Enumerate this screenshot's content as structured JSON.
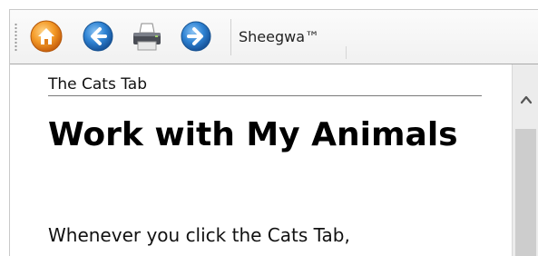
{
  "toolbar": {
    "buttons": [
      {
        "icon": "home-icon"
      },
      {
        "icon": "back-arrow-icon"
      },
      {
        "icon": "printer-icon"
      },
      {
        "icon": "forward-arrow-icon"
      }
    ],
    "brand": "Sheegwa™"
  },
  "content": {
    "breadcrumb": "The Cats Tab",
    "title": "Work with My Animals",
    "body": "Whenever you click the Cats Tab,"
  },
  "scrollbar": {
    "up_icon": "chevron-up-icon"
  },
  "colors": {
    "home_orange": "#f08a1d",
    "nav_blue": "#2b7fd1",
    "scroll_thumb": "#cdcdcd"
  }
}
